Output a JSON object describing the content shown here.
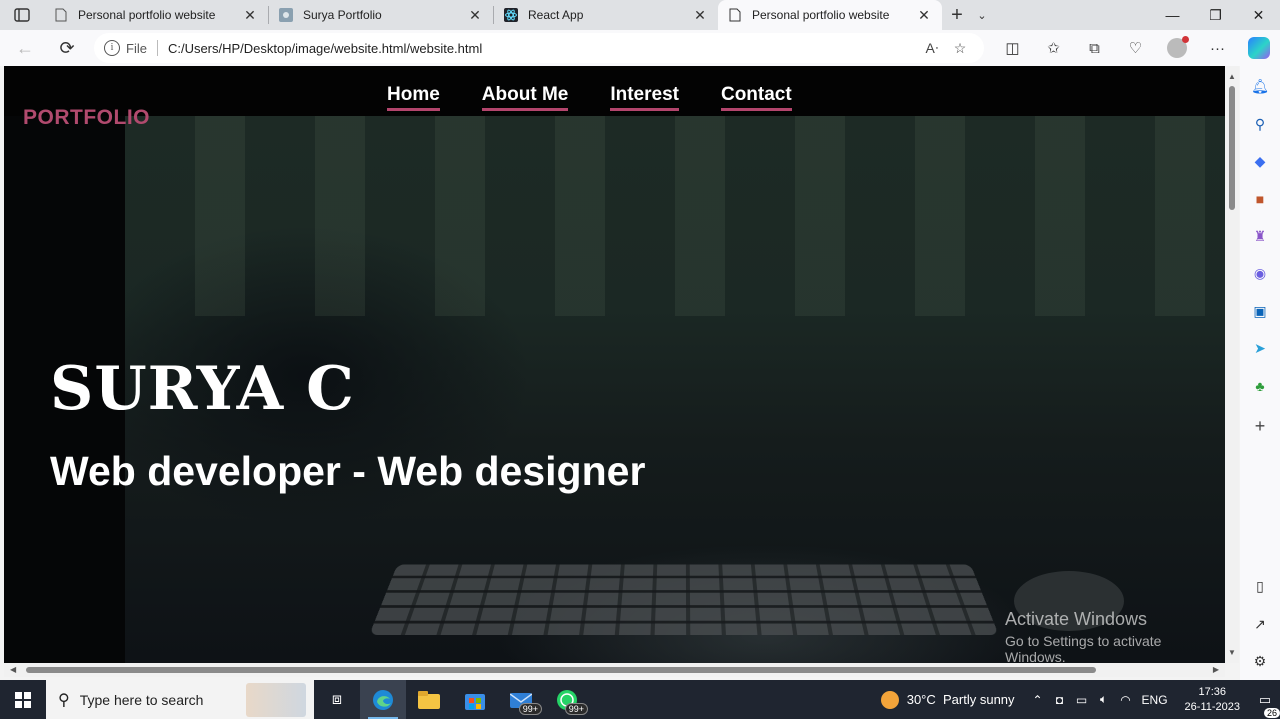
{
  "browser": {
    "tabs": [
      {
        "title": "Personal portfolio website",
        "active": false,
        "icon": "page-icon"
      },
      {
        "title": "Surya Portfolio",
        "active": false,
        "icon": "gear-favicon"
      },
      {
        "title": "React App",
        "active": false,
        "icon": "react-favicon"
      },
      {
        "title": "Personal portfolio website",
        "active": true,
        "icon": "page-icon"
      }
    ],
    "address_bar": {
      "scheme_label": "File",
      "url": "C:/Users/HP/Desktop/image/website.html/website.html"
    }
  },
  "page": {
    "brand": "PORTFOLIO",
    "nav": [
      {
        "label": "Home"
      },
      {
        "label": "About Me"
      },
      {
        "label": "Interest"
      },
      {
        "label": "Contact"
      }
    ],
    "hero": {
      "name": "SURYA C",
      "role": "Web developer - Web designer"
    },
    "accent_color": "#b3456d"
  },
  "watermark": {
    "line1": "Activate Windows",
    "line2": "Go to Settings to activate Windows."
  },
  "taskbar": {
    "search_placeholder": "Type here to search",
    "badges": {
      "mail": "99+",
      "whatsapp": "99+"
    },
    "weather": {
      "temp": "30°C",
      "condition": "Partly sunny"
    },
    "language": "ENG",
    "time": "17:36",
    "date": "26-11-2023",
    "notifications": "26"
  }
}
